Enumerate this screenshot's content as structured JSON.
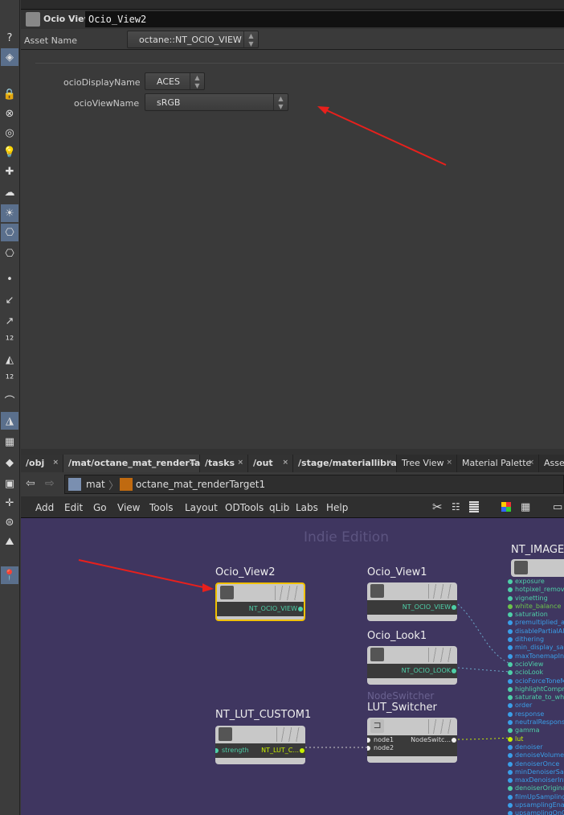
{
  "toolbar": {
    "icons": [
      "help-icon",
      "geometry-icon",
      "lock-icon",
      "close-circle-icon",
      "ambient-light-icon",
      "light-bulb-icon",
      "point-light-icon",
      "sky-light-icon",
      "environment-light-icon",
      "camera-icon",
      "stereo-camera-icon",
      "null-icon",
      "bone-icon",
      "pin-icon",
      "distance-12-icon",
      "paint-icon",
      "distance-tool-icon",
      "curve-icon",
      "sculpt-icon",
      "checker-icon",
      "diamond-icon",
      "box-icon",
      "axis-icon",
      "barrel-icon",
      "terrain-icon",
      "pin-location-icon"
    ]
  },
  "params": {
    "node_type": "Ocio View",
    "node_name": "Ocio_View2",
    "asset_label": "Asset Name",
    "asset_value": "octane::NT_OCIO_VIEW",
    "rows": [
      {
        "label": "ocioDisplayName",
        "value": "ACES"
      },
      {
        "label": "ocioViewName",
        "value": "sRGB"
      }
    ]
  },
  "tabs": [
    {
      "label": "/obj"
    },
    {
      "label": "/mat/octane_mat_renderTar..."
    },
    {
      "label": "/tasks"
    },
    {
      "label": "/out"
    },
    {
      "label": "/stage/materiallibra..."
    },
    {
      "label": "Tree View"
    },
    {
      "label": "Material Palette"
    },
    {
      "label": "Asse"
    }
  ],
  "path": {
    "root": "mat",
    "node": "octane_mat_renderTarget1"
  },
  "menu": [
    "Add",
    "Edit",
    "Go",
    "View",
    "Tools",
    "Layout",
    "ODTools",
    "qLib",
    "Labs",
    "Help"
  ],
  "network": {
    "watermark": "Indie Edition",
    "nodes": {
      "ocio_view2": {
        "name": "Ocio_View2",
        "output": "NT_OCIO_VIEW"
      },
      "ocio_view1": {
        "name": "Ocio_View1",
        "output": "NT_OCIO_VIEW"
      },
      "ocio_look1": {
        "name": "Ocio_Look1",
        "output": "NT_OCIO_LOOK"
      },
      "lut_switcher": {
        "type": "NodeSwitcher",
        "name": "LUT_Switcher",
        "inputs": [
          "node1",
          "node2"
        ],
        "output": "NodeSwitc..."
      },
      "lut_custom": {
        "name": "NT_LUT_CUSTOM1",
        "input": "strength",
        "output": "NT_LUT_C..."
      },
      "imager": {
        "name": "NT_IMAGEI"
      }
    },
    "imager_ports": [
      {
        "name": "exposure",
        "color": "#4ecfa8"
      },
      {
        "name": "hotpixel_remova",
        "color": "#4ecfa8"
      },
      {
        "name": "vignetting",
        "color": "#4ecfa8"
      },
      {
        "name": "white_balance",
        "color": "#6cc24a"
      },
      {
        "name": "saturation",
        "color": "#4ecfa8"
      },
      {
        "name": "premultiplied_alp",
        "color": "#3a9ee8"
      },
      {
        "name": "disablePartialAlp",
        "color": "#3a9ee8"
      },
      {
        "name": "dithering",
        "color": "#3a9ee8"
      },
      {
        "name": "min_display_sam",
        "color": "#3a9ee8"
      },
      {
        "name": "maxTonemapInte",
        "color": "#3a9ee8"
      },
      {
        "name": "ocioView",
        "color": "#4ecfa8"
      },
      {
        "name": "ocioLook",
        "color": "#4ecfa8"
      },
      {
        "name": "ocioForceToneMa",
        "color": "#3a9ee8"
      },
      {
        "name": "highlightCompre",
        "color": "#4ecfa8"
      },
      {
        "name": "saturate_to_whit",
        "color": "#4ecfa8"
      },
      {
        "name": "order",
        "color": "#3a9ee8"
      },
      {
        "name": "response",
        "color": "#3a9ee8"
      },
      {
        "name": "neutralResponse",
        "color": "#3a9ee8"
      },
      {
        "name": "gamma",
        "color": "#4ecfa8"
      },
      {
        "name": "lut",
        "color": "#c8f000"
      },
      {
        "name": "denoiser",
        "color": "#3a9ee8"
      },
      {
        "name": "denoiseVolume",
        "color": "#3a9ee8"
      },
      {
        "name": "denoiserOnce",
        "color": "#3a9ee8"
      },
      {
        "name": "minDenoiserSam",
        "color": "#3a9ee8"
      },
      {
        "name": "maxDenoiserInte",
        "color": "#3a9ee8"
      },
      {
        "name": "denoiserOriginal",
        "color": "#4ecfa8"
      },
      {
        "name": "filmUpSamplingK",
        "color": "#3a9ee8"
      },
      {
        "name": "upsamplingEnab",
        "color": "#3a9ee8"
      },
      {
        "name": "upsamplingOnC",
        "color": "#3a9ee8"
      }
    ]
  },
  "colors": {
    "network_bg": "#3f3660",
    "selected_node": "#f0c000",
    "annotation_arrow": "#e8201c"
  }
}
